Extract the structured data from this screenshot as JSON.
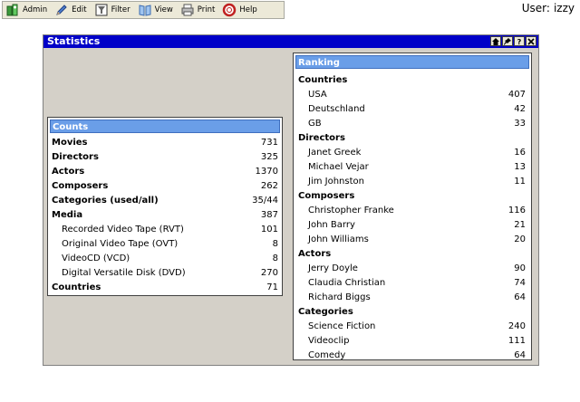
{
  "toolbar": {
    "buttons": [
      {
        "label": "Admin",
        "icon": "admin-icon"
      },
      {
        "label": "Edit",
        "icon": "edit-icon"
      },
      {
        "label": "Filter",
        "icon": "filter-icon"
      },
      {
        "label": "View",
        "icon": "view-icon"
      },
      {
        "label": "Print",
        "icon": "print-icon"
      },
      {
        "label": "Help",
        "icon": "help-icon"
      }
    ]
  },
  "user": {
    "label": "User:",
    "name": "izzy"
  },
  "panel": {
    "title": "Statistics"
  },
  "counts": {
    "title": "Counts",
    "rows": [
      {
        "label": "Movies",
        "value": "731"
      },
      {
        "label": "Directors",
        "value": "325"
      },
      {
        "label": "Actors",
        "value": "1370"
      },
      {
        "label": "Composers",
        "value": "262"
      },
      {
        "label": "Categories (used/all)",
        "value": "35/44"
      },
      {
        "label": "Media",
        "value": "387"
      },
      {
        "label": "Recorded Video Tape (RVT)",
        "value": "101"
      },
      {
        "label": "Original Video Tape (OVT)",
        "value": "8"
      },
      {
        "label": "VideoCD (VCD)",
        "value": "8"
      },
      {
        "label": "Digital Versatile Disk (DVD)",
        "value": "270"
      },
      {
        "label": "Countries",
        "value": "71"
      }
    ]
  },
  "ranking": {
    "title": "Ranking",
    "sections": [
      {
        "title": "Countries",
        "rows": [
          {
            "label": "USA",
            "value": "407"
          },
          {
            "label": "Deutschland",
            "value": "42"
          },
          {
            "label": "GB",
            "value": "33"
          }
        ]
      },
      {
        "title": "Directors",
        "rows": [
          {
            "label": "Janet Greek",
            "value": "16"
          },
          {
            "label": "Michael Vejar",
            "value": "13"
          },
          {
            "label": "Jim Johnston",
            "value": "11"
          }
        ]
      },
      {
        "title": "Composers",
        "rows": [
          {
            "label": "Christopher Franke",
            "value": "116"
          },
          {
            "label": "John Barry",
            "value": "21"
          },
          {
            "label": "John Williams",
            "value": "20"
          }
        ]
      },
      {
        "title": "Actors",
        "rows": [
          {
            "label": "Jerry Doyle",
            "value": "90"
          },
          {
            "label": "Claudia Christian",
            "value": "74"
          },
          {
            "label": "Richard Biggs",
            "value": "64"
          }
        ]
      },
      {
        "title": "Categories",
        "rows": [
          {
            "label": "Science Fiction",
            "value": "240"
          },
          {
            "label": "Videoclip",
            "value": "111"
          },
          {
            "label": "Comedy",
            "value": "64"
          }
        ]
      }
    ]
  },
  "colors": {
    "title_bar": "#0000c8",
    "box_header": "#6a9ee8",
    "panel_bg": "#d4d0c8"
  }
}
